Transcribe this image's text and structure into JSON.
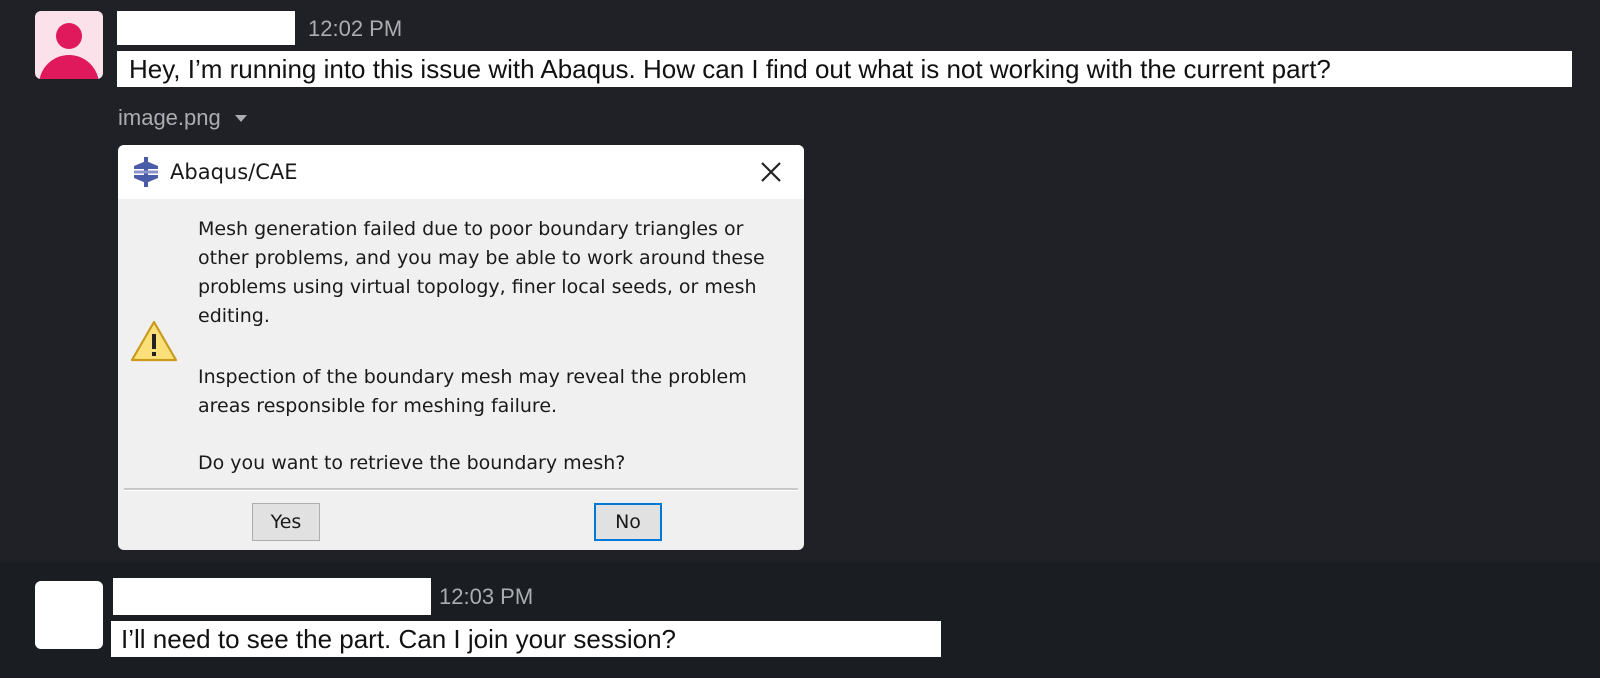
{
  "messages": [
    {
      "timestamp": "12:02 PM",
      "text": "Hey, I’m running into this issue with Abaqus. How can I find out what is not working with the current part?",
      "attachment": {
        "filename": "image.png",
        "dialog": {
          "title": "Abaqus/CAE",
          "paragraph1": "Mesh generation failed due to poor boundary triangles or other problems, and you may be able to work around these problems using virtual topology, finer local seeds, or mesh editing.",
          "paragraph2": "Inspection of the boundary mesh may reveal the problem areas responsible for meshing failure.",
          "question": "Do you want to retrieve the boundary mesh?",
          "yes_label": "Yes",
          "no_label": "No",
          "icons": {
            "app": "abaqus-logo-icon",
            "warning": "warning-icon",
            "close": "close-icon"
          }
        }
      }
    },
    {
      "timestamp": "12:03 PM",
      "text": "I’ll need to see the part. Can I join your session?"
    }
  ],
  "colors": {
    "background": "#1a1d21",
    "avatar_accent": "#e0195c",
    "dialog_focus": "#0078d7"
  }
}
